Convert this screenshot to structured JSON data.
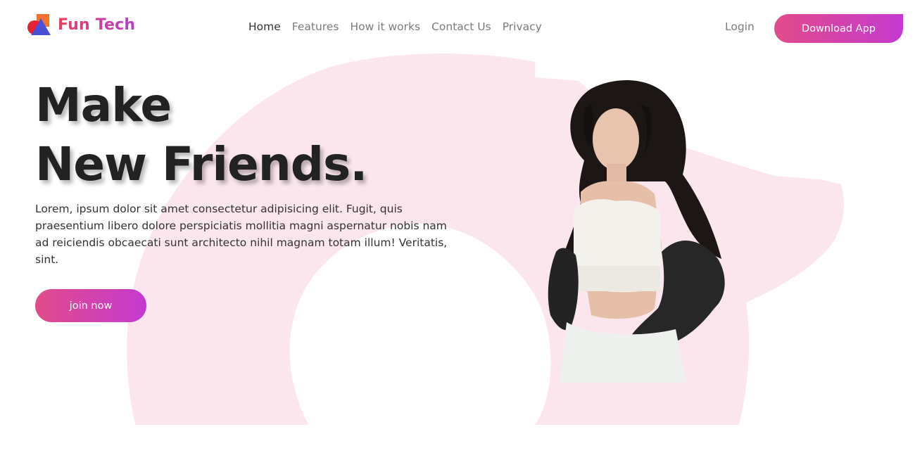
{
  "brand": {
    "name": "Fun Tech"
  },
  "nav": {
    "items": [
      {
        "label": "Home",
        "active": true
      },
      {
        "label": "Features",
        "active": false
      },
      {
        "label": "How it works",
        "active": false
      },
      {
        "label": "Contact Us",
        "active": false
      },
      {
        "label": "Privacy",
        "active": false
      }
    ]
  },
  "header": {
    "login_label": "Login",
    "download_label": "Download App"
  },
  "hero": {
    "title_line1": "Make",
    "title_line2": "New Friends.",
    "description": "Lorem, ipsum dolor sit amet consectetur adipisicing elit. Fugit, quis praesentium libero dolore perspiciatis mollitia magni aspernatur nobis nam ad reiciendis obcaecati sunt architecto nihil magnam totam illum! Veritatis, sint.",
    "cta_label": "join now",
    "image": "woman-portrait-photo"
  },
  "colors": {
    "accent_start": "#e24b8a",
    "accent_end": "#c43ad0",
    "blob": "#fbe6ee",
    "text_dark": "#222222",
    "nav_muted": "#7c7c7c"
  }
}
